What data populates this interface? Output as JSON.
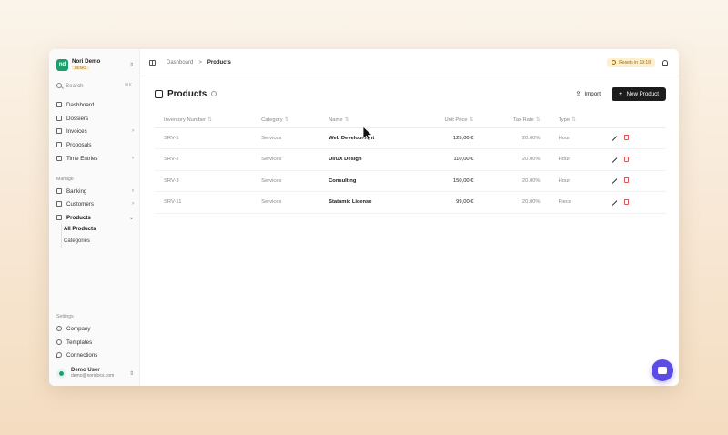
{
  "org": {
    "name": "Nori Demo",
    "badge": "DEMO",
    "logo_text": "nd"
  },
  "search": {
    "label": "Search",
    "shortcut": "⌘K"
  },
  "nav": [
    {
      "label": "Dashboard",
      "icon": "dashboard-icon"
    },
    {
      "label": "Dossiers",
      "icon": "folder-icon"
    },
    {
      "label": "Invoices",
      "icon": "invoice-icon",
      "chevron": "›"
    },
    {
      "label": "Proposals",
      "icon": "proposal-icon"
    },
    {
      "label": "Time Entries",
      "icon": "clock-icon",
      "chevron": "›"
    }
  ],
  "manage": {
    "label": "Manage",
    "items": [
      {
        "label": "Banking",
        "icon": "bank-icon",
        "chevron": "›"
      },
      {
        "label": "Customers",
        "icon": "users-icon",
        "chevron": "›"
      },
      {
        "label": "Products",
        "icon": "box-icon",
        "chevron": "⌄"
      }
    ],
    "sub_items": [
      "All Products",
      "Categories"
    ]
  },
  "settings": {
    "label": "Settings",
    "items": [
      {
        "label": "Company",
        "icon": "globe-icon"
      },
      {
        "label": "Templates",
        "icon": "palette-icon"
      },
      {
        "label": "Connections",
        "icon": "pin-icon"
      }
    ]
  },
  "user": {
    "name": "Demo User",
    "email": "demo@noridocs.com"
  },
  "breadcrumb": {
    "parent": "Dashboard",
    "separator": ">",
    "current": "Products"
  },
  "reset_badge": "Resets in 19:18",
  "page": {
    "title": "Products",
    "import_label": "Import",
    "new_label": "New Product",
    "new_icon": "+"
  },
  "table": {
    "columns": [
      "Inventory Number",
      "Category",
      "Name",
      "Unit Price",
      "Tax Rate",
      "Type"
    ],
    "sort_glyph": "⇅",
    "rows": [
      {
        "inventory": "SRV-1",
        "category": "Services",
        "name": "Web Development",
        "price": "125,00 €",
        "tax": "20.00%",
        "type": "Hour"
      },
      {
        "inventory": "SRV-2",
        "category": "Services",
        "name": "UI/UX Design",
        "price": "110,00 €",
        "tax": "20.00%",
        "type": "Hour"
      },
      {
        "inventory": "SRV-3",
        "category": "Services",
        "name": "Consulting",
        "price": "150,00 €",
        "tax": "20.00%",
        "type": "Hour"
      },
      {
        "inventory": "SRV-11",
        "category": "Services",
        "name": "Statamic License",
        "price": "99,00 €",
        "tax": "20.00%",
        "type": "Piece"
      }
    ]
  },
  "colors": {
    "brand": "#1f9d6b",
    "chat": "#5b4ce6",
    "delete": "#e25555",
    "badge_bg": "#fdf0cf"
  }
}
